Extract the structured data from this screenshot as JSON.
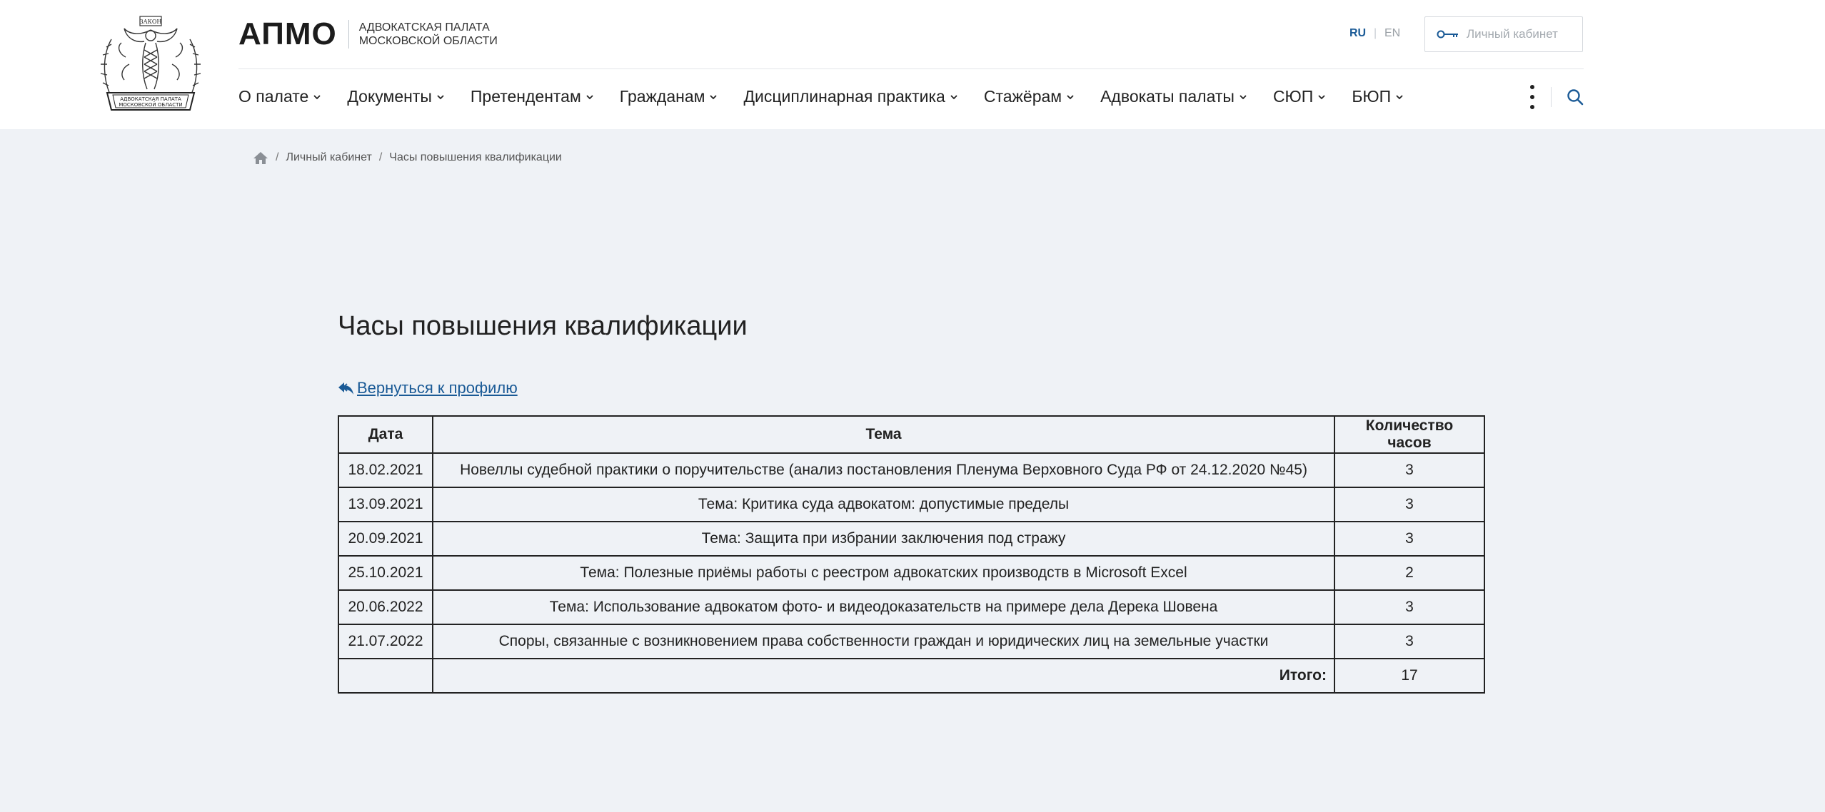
{
  "header": {
    "brand_abbr": "АПМО",
    "brand_name_line1": "АДВОКАТСКАЯ ПАЛАТА",
    "brand_name_line2": "МОСКОВСКОЙ ОБЛАСТИ",
    "emblem_text_top": "ЗАКОН",
    "emblem_text_line1": "АДВОКАТСКАЯ ПАЛАТА",
    "emblem_text_line2": "МОСКОВСКОЙ ОБЛАСТИ",
    "lang_ru": "RU",
    "lang_divider": "|",
    "lang_en": "EN",
    "cabinet_label": "Личный кабинет",
    "accent_color": "#1a5a96"
  },
  "nav": {
    "items": [
      {
        "label": "О палате",
        "icon": "chevron-down-icon"
      },
      {
        "label": "Документы",
        "icon": "chevron-down-icon"
      },
      {
        "label": "Претендентам",
        "icon": "chevron-down-icon"
      },
      {
        "label": "Гражданам",
        "icon": "chevron-down-icon"
      },
      {
        "label": "Дисциплинарная практика",
        "icon": "chevron-down-icon"
      },
      {
        "label": "Стажёрам",
        "icon": "chevron-down-icon"
      },
      {
        "label": "Адвокаты палаты",
        "icon": "chevron-down-icon"
      },
      {
        "label": "СЮП",
        "icon": "chevron-down-icon"
      },
      {
        "label": "БЮП",
        "icon": "chevron-down-icon"
      }
    ],
    "more_icon": "kebab-icon",
    "search_icon": "search-icon"
  },
  "breadcrumb": {
    "home_icon": "home-icon",
    "separator": "/",
    "items": [
      "Личный кабинет",
      "Часы повышения квалификации"
    ]
  },
  "page": {
    "title": "Часы повышения квалификации",
    "back_link": "Вернуться к профилю",
    "back_icon": "reply-icon"
  },
  "table": {
    "headers": [
      "Дата",
      "Тема",
      "Количество часов"
    ],
    "rows": [
      {
        "date": "18.02.2021",
        "topic": "Новеллы судебной практики о поручительстве (анализ постановления Пленума Верховного Суда РФ от 24.12.2020 №45)",
        "hours": "3"
      },
      {
        "date": "13.09.2021",
        "topic": "Тема: Критика суда адвокатом: допустимые пределы",
        "hours": "3"
      },
      {
        "date": "20.09.2021",
        "topic": "Тема: Защита при избрании заключения под стражу",
        "hours": "3"
      },
      {
        "date": "25.10.2021",
        "topic": "Тема: Полезные приёмы работы с реестром адвокатских производств в Microsoft Excel",
        "hours": "2"
      },
      {
        "date": "20.06.2022",
        "topic": "Тема: Использование адвокатом фото- и видеодоказательств на примере дела Дерека Шовена",
        "hours": "3"
      },
      {
        "date": "21.07.2022",
        "topic": "Споры, связанные с возникновением права собственности граждан и юридических лиц на земельные участки",
        "hours": "3"
      }
    ],
    "total_label": "Итого:",
    "total_value": "17"
  }
}
